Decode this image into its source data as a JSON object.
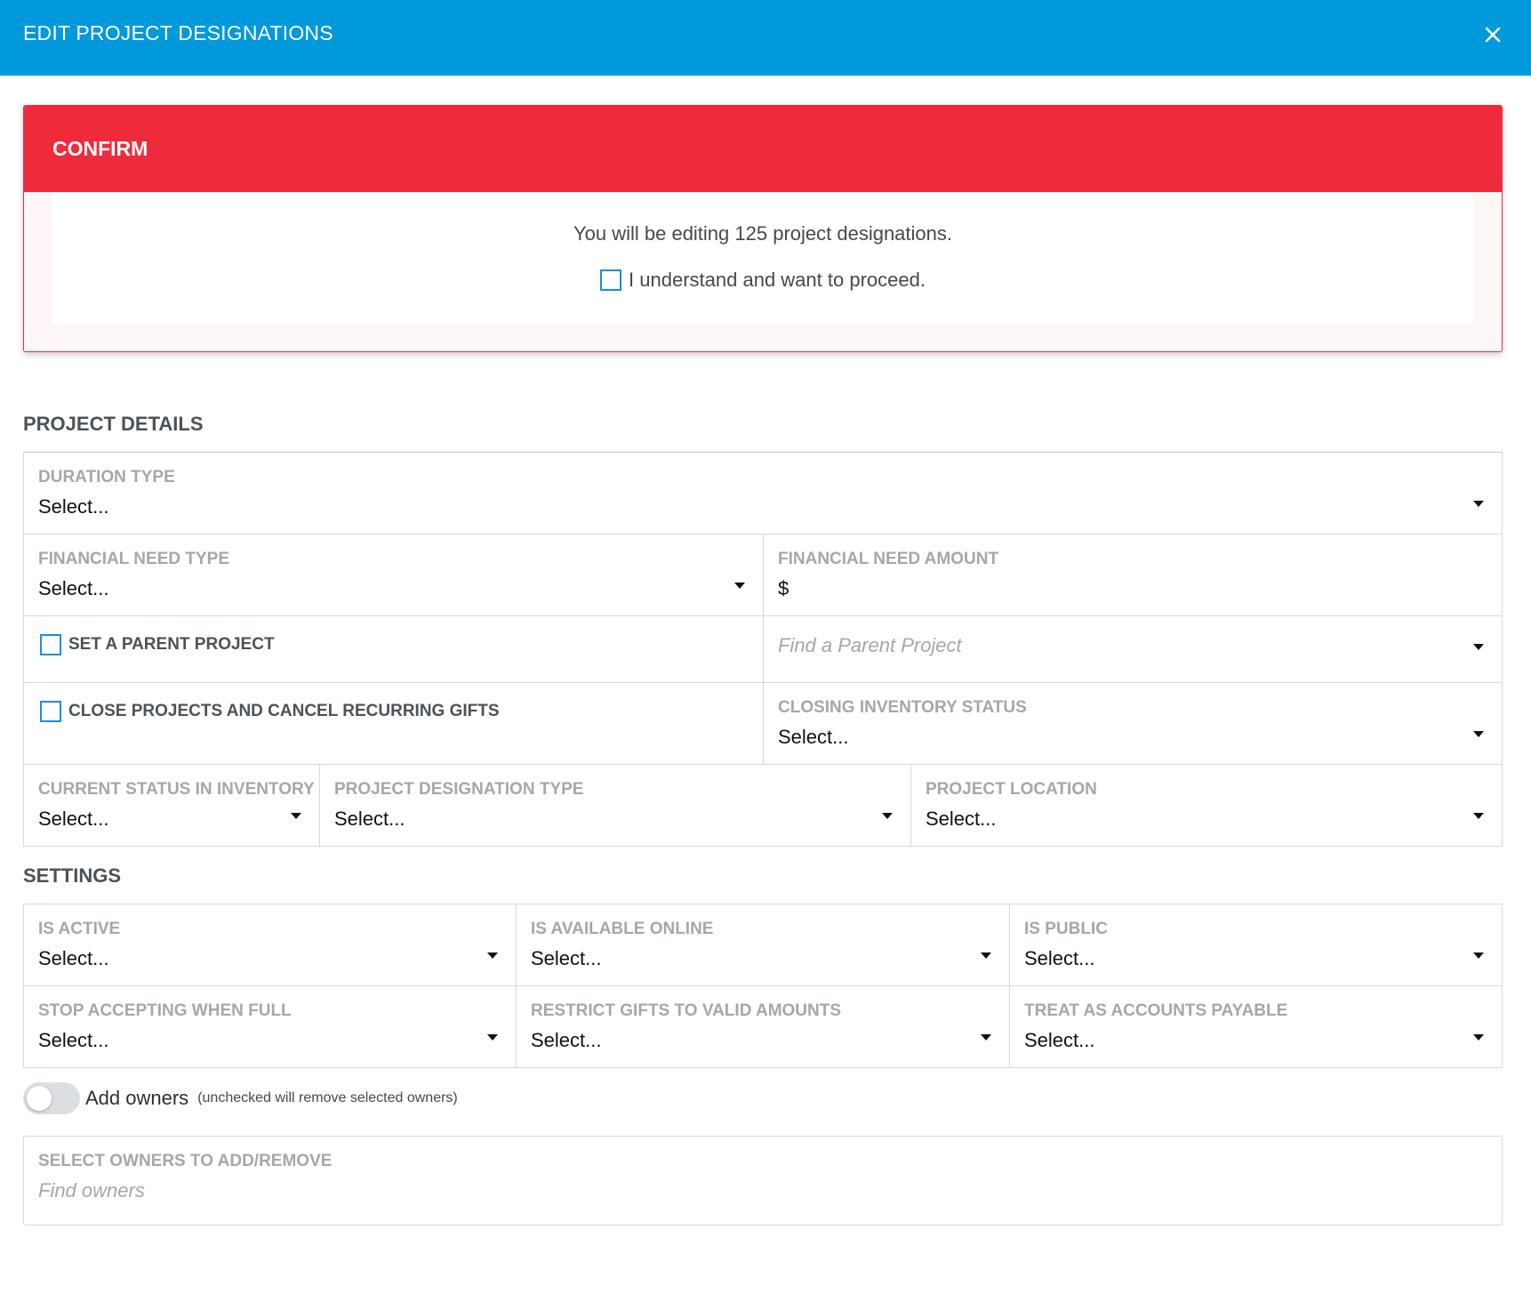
{
  "header": {
    "title": "EDIT PROJECT DESIGNATIONS",
    "close_icon": "close-icon"
  },
  "confirm": {
    "title": "CONFIRM",
    "message": "You will be editing 125 project designations.",
    "checkbox_label": "I understand and want to proceed."
  },
  "project_details": {
    "title": "PROJECT DETAILS",
    "duration_type": {
      "label": "DURATION TYPE",
      "value": "Select..."
    },
    "financial_need_type": {
      "label": "FINANCIAL NEED TYPE",
      "value": "Select..."
    },
    "financial_need_amount": {
      "label": "FINANCIAL NEED AMOUNT",
      "value": "$"
    },
    "set_parent_project": {
      "label": "SET A PARENT PROJECT"
    },
    "find_parent_project": {
      "placeholder": "Find a Parent Project"
    },
    "close_projects": {
      "label": "CLOSE PROJECTS AND CANCEL RECURRING GIFTS"
    },
    "closing_inventory_status": {
      "label": "CLOSING INVENTORY STATUS",
      "value": "Select..."
    },
    "current_status_inventory": {
      "label": "CURRENT STATUS IN INVENTORY",
      "value": "Select..."
    },
    "project_designation_type": {
      "label": "PROJECT DESIGNATION TYPE",
      "value": "Select..."
    },
    "project_location": {
      "label": "PROJECT LOCATION",
      "value": "Select..."
    }
  },
  "settings": {
    "title": "SETTINGS",
    "is_active": {
      "label": "IS ACTIVE",
      "value": "Select..."
    },
    "is_available_online": {
      "label": "IS AVAILABLE ONLINE",
      "value": "Select..."
    },
    "is_public": {
      "label": "IS PUBLIC",
      "value": "Select..."
    },
    "stop_accepting": {
      "label": "STOP ACCEPTING WHEN FULL",
      "value": "Select..."
    },
    "restrict_gifts": {
      "label": "RESTRICT GIFTS TO VALID AMOUNTS",
      "value": "Select..."
    },
    "accounts_payable": {
      "label": "TREAT AS ACCOUNTS PAYABLE",
      "value": "Select..."
    }
  },
  "owners": {
    "toggle_label": "Add owners",
    "toggle_note": "(unchecked will remove selected owners)",
    "field_label": "SELECT OWNERS TO ADD/REMOVE",
    "placeholder": "Find owners"
  }
}
